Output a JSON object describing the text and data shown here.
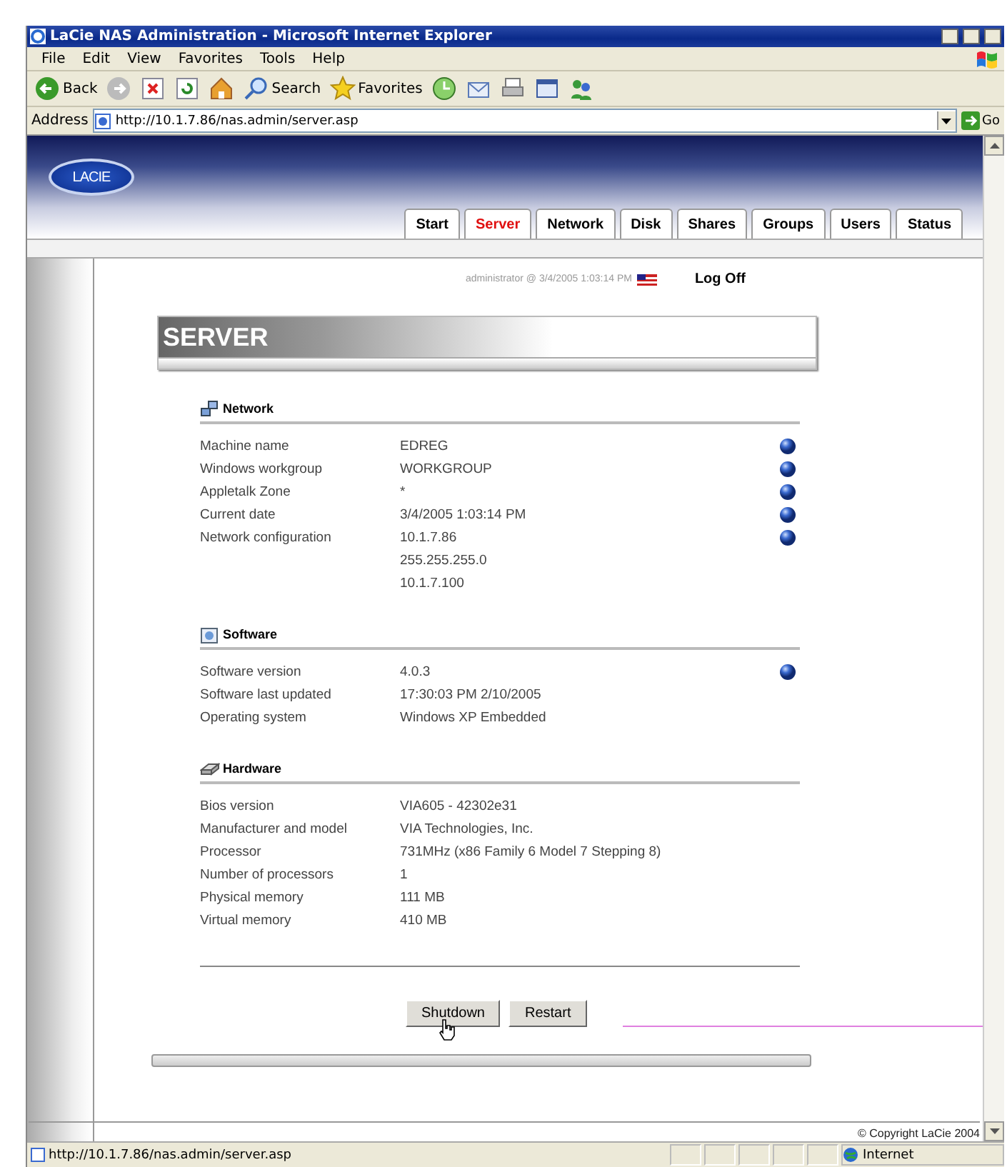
{
  "window": {
    "title": "LaCie NAS Administration - Microsoft Internet Explorer"
  },
  "menu": [
    "File",
    "Edit",
    "View",
    "Favorites",
    "Tools",
    "Help"
  ],
  "toolbar": [
    {
      "kind": "back",
      "label": "Back"
    },
    {
      "kind": "forward"
    },
    {
      "kind": "stop"
    },
    {
      "kind": "refresh"
    },
    {
      "kind": "home"
    },
    {
      "kind": "search",
      "label": "Search"
    },
    {
      "kind": "favorites",
      "label": "Favorites"
    },
    {
      "kind": "history"
    },
    {
      "kind": "mail"
    },
    {
      "kind": "print"
    },
    {
      "kind": "edit"
    },
    {
      "kind": "messenger"
    }
  ],
  "address": {
    "label": "Address",
    "value": "http://10.1.7.86/nas.admin/server.asp",
    "go": "Go"
  },
  "logo": "LACIE",
  "tabs": [
    {
      "label": "Start",
      "selected": false
    },
    {
      "label": "Server",
      "selected": true
    },
    {
      "label": "Network",
      "selected": false
    },
    {
      "label": "Disk",
      "selected": false
    },
    {
      "label": "Shares",
      "selected": false
    },
    {
      "label": "Groups",
      "selected": false
    },
    {
      "label": "Users",
      "selected": false
    },
    {
      "label": "Status",
      "selected": false
    }
  ],
  "user_line": "administrator @ 3/4/2005 1:03:14 PM",
  "logoff": "Log Off",
  "page_title": "SERVER",
  "sections": [
    {
      "kind": "network",
      "title": "Network",
      "rows": [
        {
          "label": "Machine name",
          "values": [
            "EDREG"
          ],
          "editable": true
        },
        {
          "label": "Windows workgroup",
          "values": [
            "WORKGROUP"
          ],
          "editable": true
        },
        {
          "label": "Appletalk Zone",
          "values": [
            "*"
          ],
          "editable": true
        },
        {
          "label": "Current date",
          "values": [
            "3/4/2005 1:03:14 PM"
          ],
          "editable": true
        },
        {
          "label": "Network configuration",
          "values": [
            "10.1.7.86",
            "255.255.255.0",
            "10.1.7.100"
          ],
          "editable": true
        }
      ]
    },
    {
      "kind": "software",
      "title": "Software",
      "rows": [
        {
          "label": "Software version",
          "values": [
            "4.0.3"
          ],
          "editable": true
        },
        {
          "label": "Software last updated",
          "values": [
            "17:30:03 PM 2/10/2005"
          ],
          "editable": false
        },
        {
          "label": "Operating system",
          "values": [
            "Windows XP Embedded"
          ],
          "editable": false
        }
      ]
    },
    {
      "kind": "hardware",
      "title": "Hardware",
      "rows": [
        {
          "label": "Bios version",
          "values": [
            "VIA605 - 42302e31"
          ],
          "editable": false
        },
        {
          "label": "Manufacturer and model",
          "values": [
            "VIA Technologies, Inc."
          ],
          "editable": false
        },
        {
          "label": "Processor",
          "values": [
            "731MHz (x86 Family 6 Model 7 Stepping 8)"
          ],
          "editable": false
        },
        {
          "label": "Number of processors",
          "values": [
            "1"
          ],
          "editable": false
        },
        {
          "label": "Physical memory",
          "values": [
            "111 MB"
          ],
          "editable": false
        },
        {
          "label": "Virtual memory",
          "values": [
            "410 MB"
          ],
          "editable": false
        }
      ]
    }
  ],
  "buttons": [
    "Shutdown",
    "Restart"
  ],
  "copyright": "© Copyright LaCie 2004",
  "status_bar": {
    "url": "http://10.1.7.86/nas.admin/server.asp",
    "zone": "Internet"
  }
}
